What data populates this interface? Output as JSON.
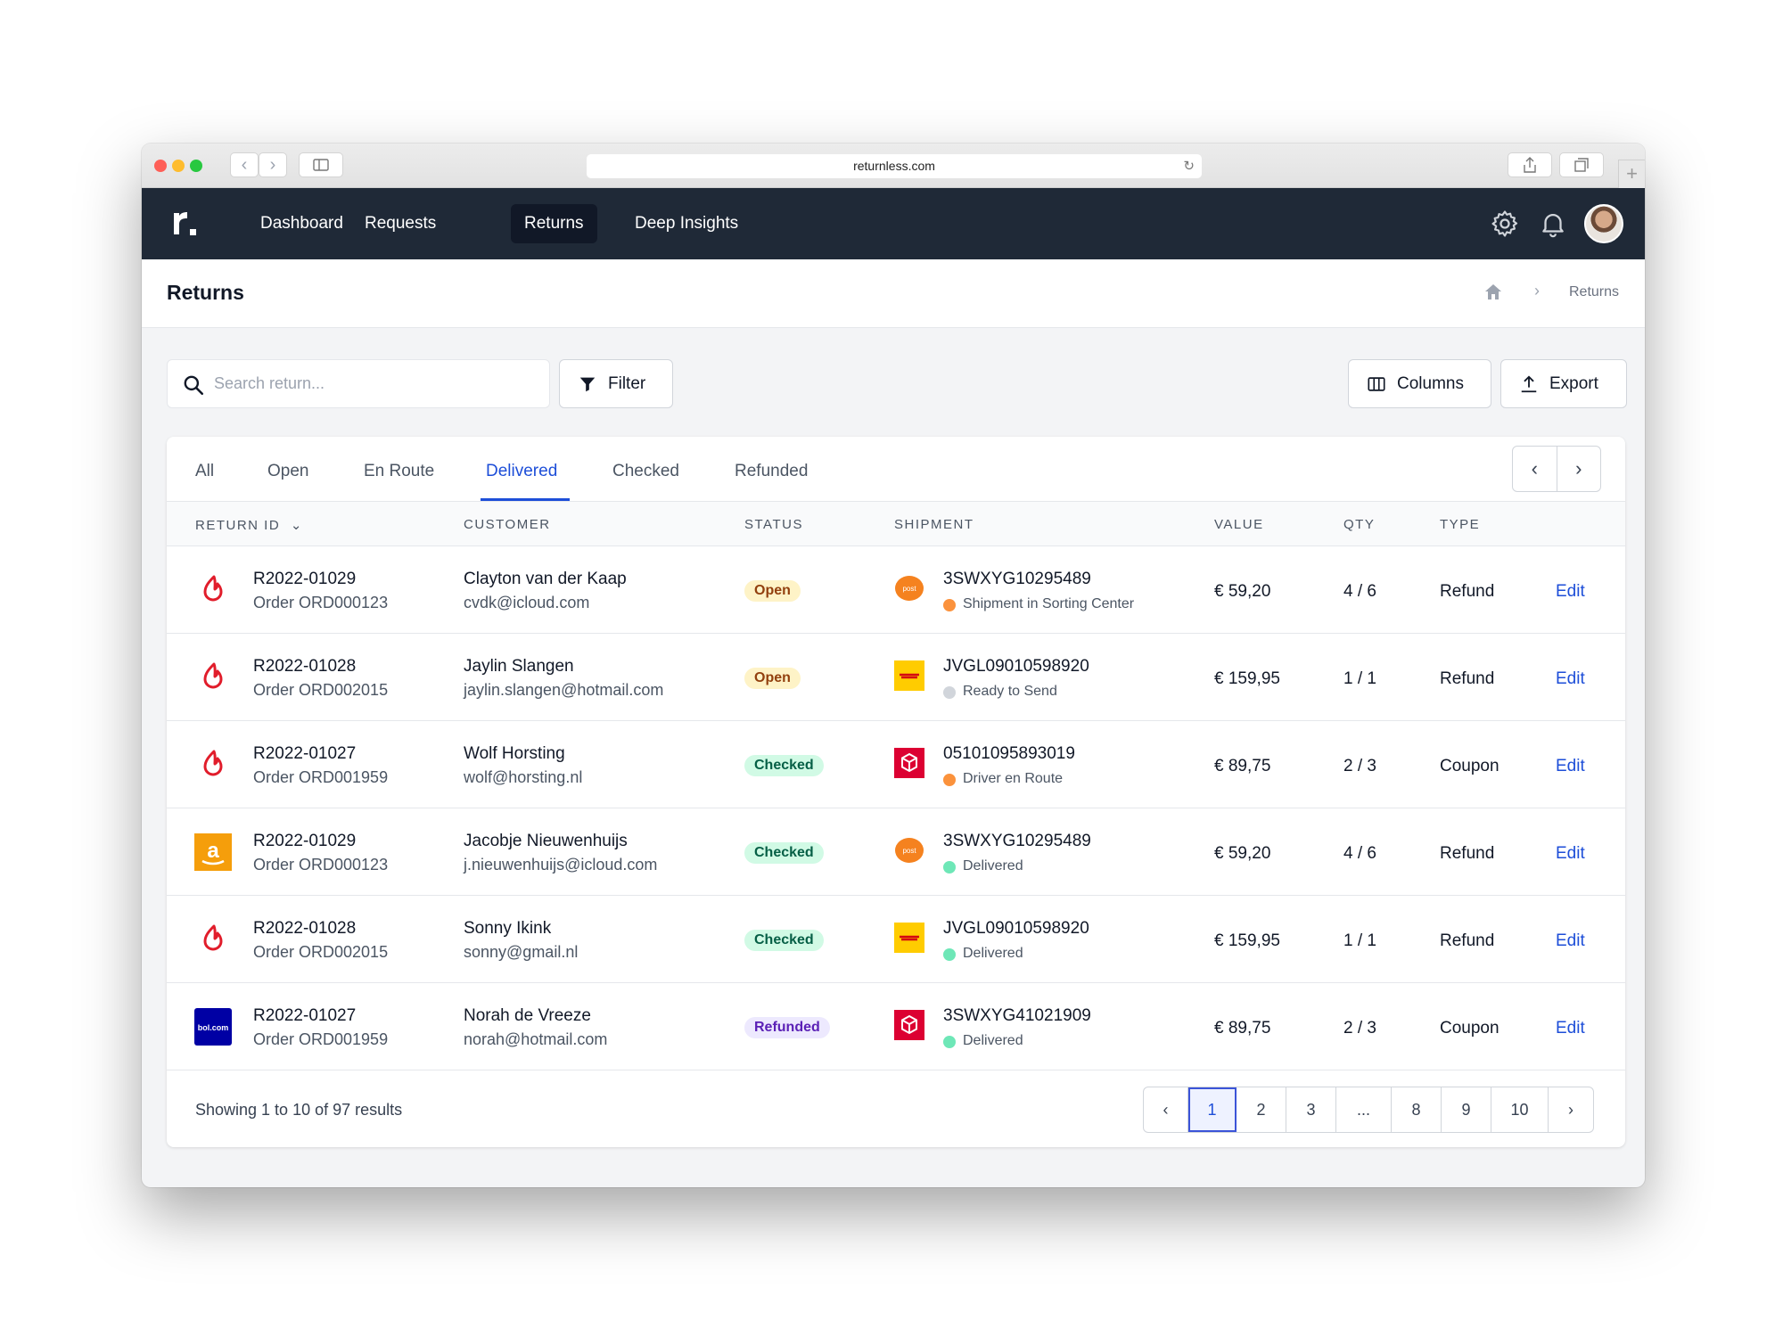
{
  "browser": {
    "url": "returnless.com"
  },
  "nav": {
    "logo": "r.",
    "items": [
      "Dashboard",
      "Requests",
      "Returns",
      "Deep Insights"
    ],
    "active": "Returns"
  },
  "header": {
    "title": "Returns",
    "breadcrumb_current": "Returns"
  },
  "toolbar": {
    "search_placeholder": "Search return...",
    "filter_label": "Filter",
    "columns_label": "Columns",
    "export_label": "Export"
  },
  "tabs": [
    "All",
    "Open",
    "En Route",
    "Delivered",
    "Checked",
    "Refunded"
  ],
  "active_tab": "Delivered",
  "table": {
    "headers": [
      "RETURN ID",
      "CUSTOMER",
      "STATUS",
      "SHIPMENT",
      "VALUE",
      "QTY",
      "TYPE"
    ],
    "rows": [
      {
        "store": "lightspeed",
        "return_id": "R2022-01029",
        "order": "Order ORD000123",
        "customer": "Clayton van der Kaap",
        "email": "cvdk@icloud.com",
        "status": "Open",
        "carrier": "postnl",
        "tracking": "3SWXYG10295489",
        "ship_status": "Shipment in Sorting Center",
        "ship_color": "#fb923c",
        "value": "€ 59,20",
        "qty": "4 / 6",
        "type": "Refund",
        "action": "Edit"
      },
      {
        "store": "lightspeed",
        "return_id": "R2022-01028",
        "order": "Order ORD002015",
        "customer": "Jaylin Slangen",
        "email": "jaylin.slangen@hotmail.com",
        "status": "Open",
        "carrier": "dhl",
        "tracking": "JVGL09010598920",
        "ship_status": "Ready to Send",
        "ship_color": "#d1d5db",
        "value": "€ 159,95",
        "qty": "1 / 1",
        "type": "Refund",
        "action": "Edit"
      },
      {
        "store": "lightspeed",
        "return_id": "R2022-01027",
        "order": "Order ORD001959",
        "customer": "Wolf Horsting",
        "email": "wolf@horsting.nl",
        "status": "Checked",
        "carrier": "dpd",
        "tracking": "05101095893019",
        "ship_status": "Driver en Route",
        "ship_color": "#fb923c",
        "value": "€ 89,75",
        "qty": "2 / 3",
        "type": "Coupon",
        "action": "Edit"
      },
      {
        "store": "amazon",
        "return_id": "R2022-01029",
        "order": "Order ORD000123",
        "customer": "Jacobje Nieuwenhuijs",
        "email": "j.nieuwenhuijs@icloud.com",
        "status": "Checked",
        "carrier": "postnl",
        "tracking": "3SWXYG10295489",
        "ship_status": "Delivered",
        "ship_color": "#6ee7b7",
        "value": "€ 59,20",
        "qty": "4 / 6",
        "type": "Refund",
        "action": "Edit"
      },
      {
        "store": "lightspeed",
        "return_id": "R2022-01028",
        "order": "Order ORD002015",
        "customer": "Sonny Ikink",
        "email": "sonny@gmail.nl",
        "status": "Checked",
        "carrier": "dhl",
        "tracking": "JVGL09010598920",
        "ship_status": "Delivered",
        "ship_color": "#6ee7b7",
        "value": "€ 159,95",
        "qty": "1 / 1",
        "type": "Refund",
        "action": "Edit"
      },
      {
        "store": "bol",
        "return_id": "R2022-01027",
        "order": "Order ORD001959",
        "customer": "Norah de Vreeze",
        "email": "norah@hotmail.com",
        "status": "Refunded",
        "carrier": "dpd",
        "tracking": "3SWXYG41021909",
        "ship_status": "Delivered",
        "ship_color": "#6ee7b7",
        "value": "€ 89,75",
        "qty": "2 / 3",
        "type": "Coupon",
        "action": "Edit"
      }
    ]
  },
  "footer": {
    "results_text": "Showing 1 to 10 of 97 results",
    "pages": [
      "1",
      "2",
      "3",
      "...",
      "8",
      "9",
      "10"
    ],
    "current_page": "1"
  },
  "colors": {
    "nav_bg": "#1f2937",
    "accent": "#1d4ed8",
    "lightspeed": "#e11d2b",
    "amazon": "#f59e0b",
    "bol": "#0000a4",
    "postnl": "#f5821f",
    "dhl": "#ffcc00",
    "dpd": "#dc0032"
  }
}
